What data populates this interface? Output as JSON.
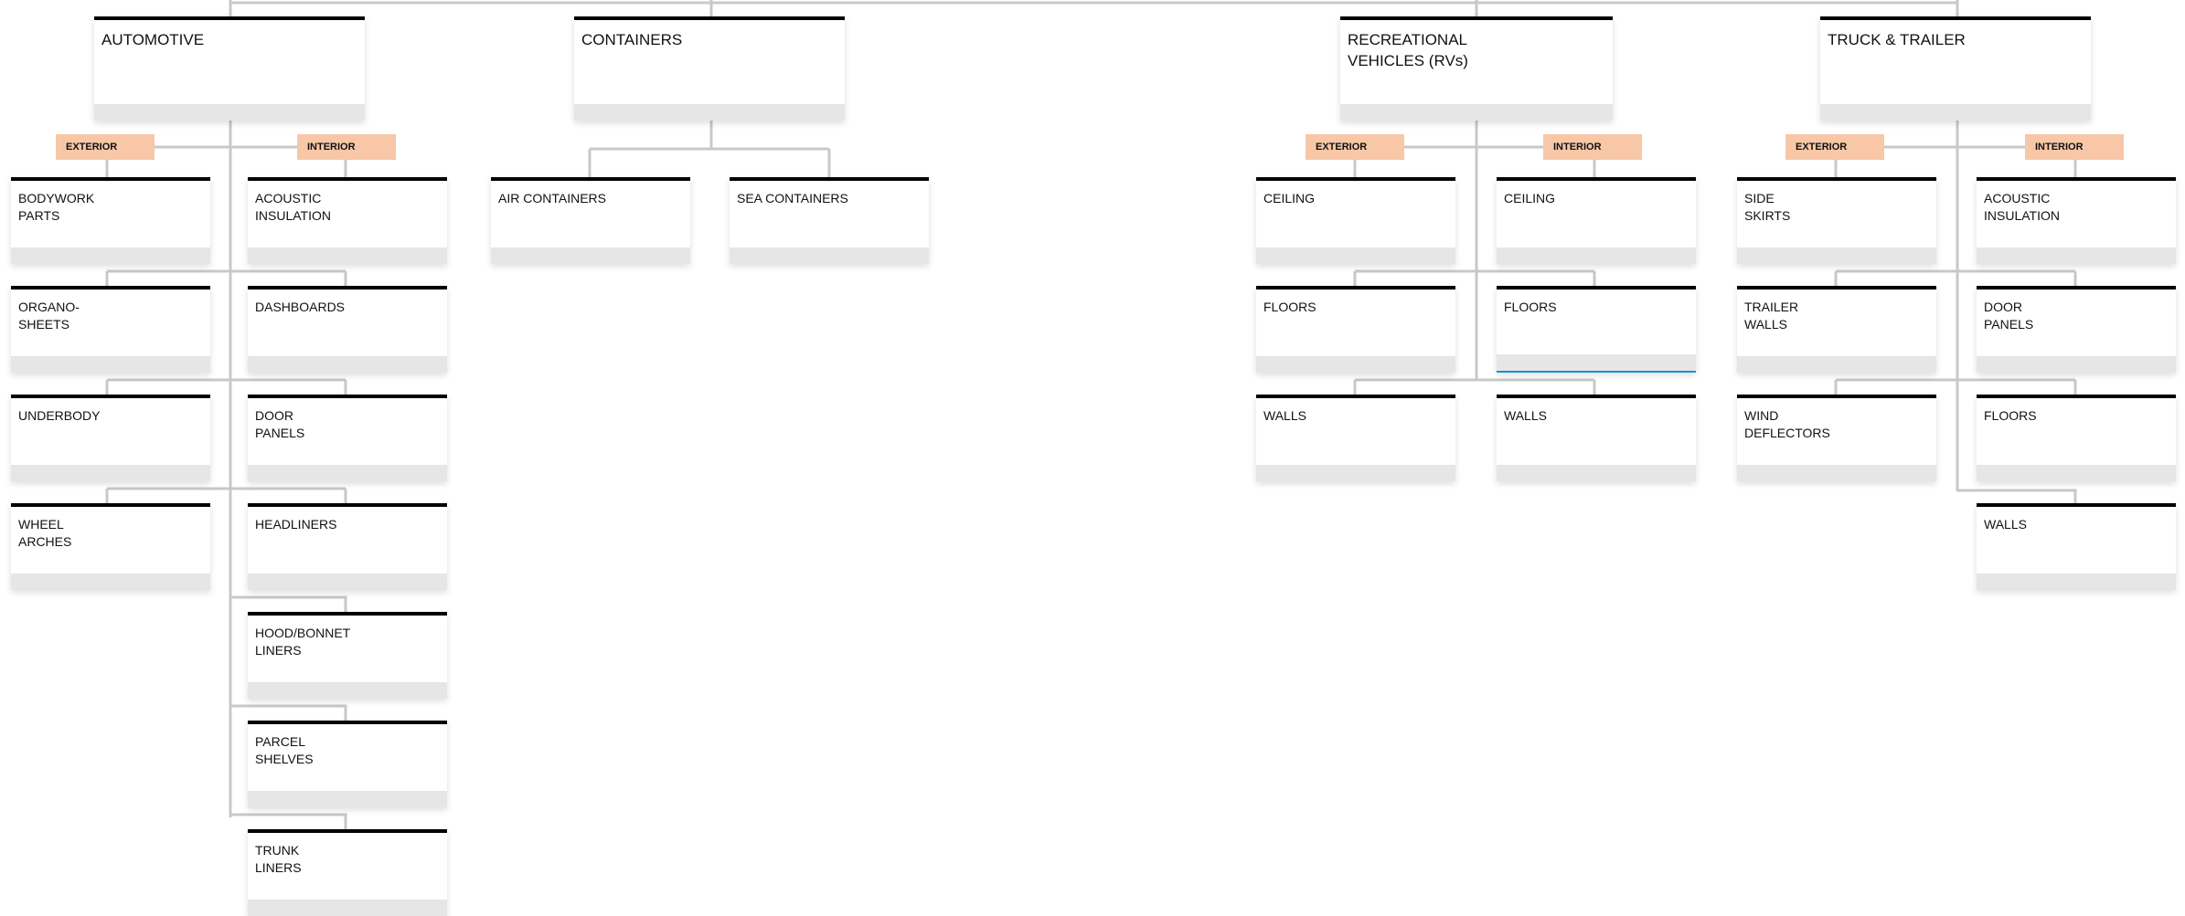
{
  "diagram": {
    "colors": {
      "connector": "#c8c8c8",
      "tag": "#f7c7a7",
      "header_border": "#000000",
      "band": "#e6e6e6",
      "selected": "#1a8fd6"
    },
    "categories": [
      {
        "id": "automotive",
        "title": "AUTOMOTIVE",
        "exterior_tag": "EXTERIOR",
        "interior_tag": "INTERIOR",
        "exterior": [
          "BODYWORK\nPARTS",
          "ORGANO-\nSHEETS",
          "UNDERBODY",
          "WHEEL\nARCHES"
        ],
        "interior": [
          "ACOUSTIC\nINSULATION",
          "DASHBOARDS",
          "DOOR\nPANELS",
          "HEADLINERS",
          "HOOD/BONNET\nLINERS",
          "PARCEL\nSHELVES",
          "TRUNK\nLINERS"
        ]
      },
      {
        "id": "containers",
        "title": "CONTAINERS",
        "children": [
          "AIR CONTAINERS",
          "SEA CONTAINERS"
        ]
      },
      {
        "id": "rvs",
        "title": "RECREATIONAL\nVEHICLES (RVs)",
        "exterior_tag": "EXTERIOR",
        "interior_tag": "INTERIOR",
        "exterior": [
          "CEILING",
          "FLOORS",
          "WALLS"
        ],
        "interior": [
          "CEILING",
          "FLOORS",
          "WALLS"
        ]
      },
      {
        "id": "truck",
        "title": "TRUCK & TRAILER",
        "exterior_tag": "EXTERIOR",
        "interior_tag": "INTERIOR",
        "exterior": [
          "SIDE\nSKIRTS",
          "TRAILER\nWALLS",
          "WIND\nDEFLECTORS"
        ],
        "interior": [
          "ACOUSTIC\nINSULATION",
          "DOOR\nPANELS",
          "FLOORS",
          "WALLS"
        ]
      }
    ]
  }
}
